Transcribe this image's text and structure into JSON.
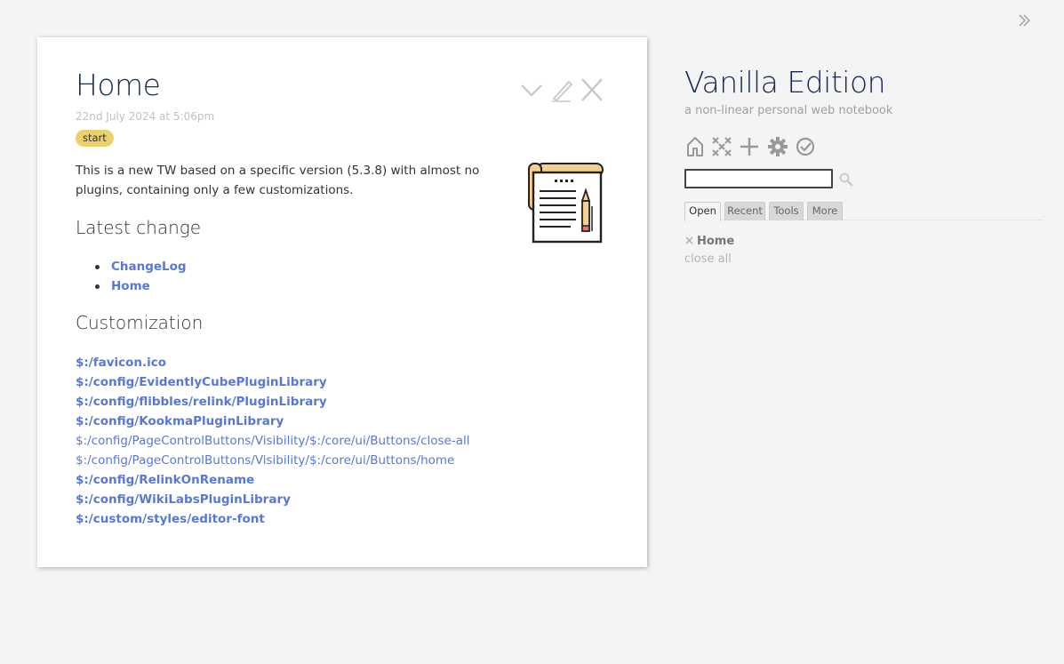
{
  "tiddler": {
    "title": "Home",
    "subtitle": "22nd July 2024 at 5:06pm",
    "tag": "start",
    "intro": "This is a new TW based on a specific version (5.3.8) with almost no plugins, containing only a few customizations.",
    "section_latest": "Latest change",
    "latest_links": [
      "ChangeLog",
      "Home"
    ],
    "section_custom": "Customization",
    "custom_links": [
      {
        "text": "$:/favicon.ico",
        "exists": true
      },
      {
        "text": "$:/config/EvidentlyCubePluginLibrary",
        "exists": true
      },
      {
        "text": "$:/config/flibbles/relink/PluginLibrary",
        "exists": true
      },
      {
        "text": "$:/config/KookmaPluginLibrary",
        "exists": true
      },
      {
        "text": "$:/config/PageControlButtons/Visibility/$:/core/ui/Buttons/close-all",
        "exists": false
      },
      {
        "text": "$:/config/PageControlButtons/Visibility/$:/core/ui/Buttons/home",
        "exists": false
      },
      {
        "text": "$:/config/RelinkOnRename",
        "exists": true
      },
      {
        "text": "$:/config/WikiLabsPluginLibrary",
        "exists": true
      },
      {
        "text": "$:/custom/styles/editor-font",
        "exists": true
      }
    ],
    "controls": [
      "chevron-down-icon",
      "edit-icon",
      "close-icon"
    ],
    "image": "notebook-pencil-icon"
  },
  "sidebar": {
    "site_title": "Vanilla Edition",
    "site_subtitle": "a non-linear personal web notebook",
    "page_buttons": [
      "home-icon",
      "close-all-icon",
      "new-tiddler-icon",
      "control-panel-icon",
      "save-wiki-icon"
    ],
    "search": {
      "value": "",
      "placeholder": ""
    },
    "tabs": [
      "Open",
      "Recent",
      "Tools",
      "More"
    ],
    "active_tab": "Open",
    "open_items": [
      "Home"
    ],
    "close_all": "close all"
  },
  "colors": {
    "title": "#182955",
    "link": "#5778d8",
    "tag_bg": "#ecd06b",
    "background": "#f4f4f4"
  }
}
